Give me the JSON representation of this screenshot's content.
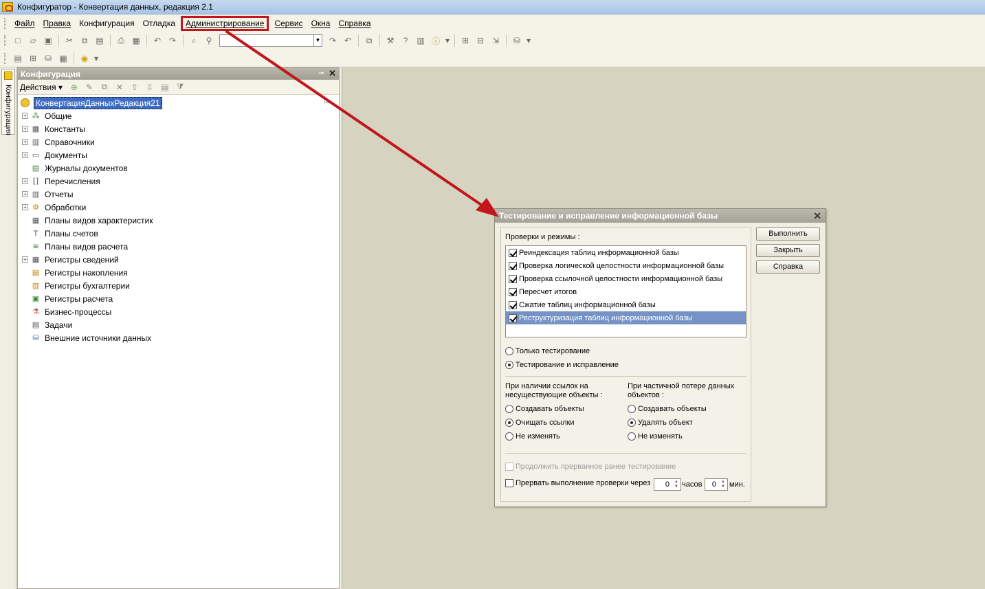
{
  "window": {
    "title": "Конфигуратор - Конвертация данных, редакция 2.1"
  },
  "menu": {
    "items": [
      "Файл",
      "Правка",
      "Конфигурация",
      "Отладка",
      "Администрирование",
      "Сервис",
      "Окна",
      "Справка"
    ]
  },
  "side_tab": {
    "label": "Конфигурация"
  },
  "config_panel": {
    "title": "Конфигурация",
    "actions_label": "Действия",
    "root": "КонвертацияДанныхРедакция21",
    "tree": [
      "Общие",
      "Константы",
      "Справочники",
      "Документы",
      "Журналы документов",
      "Перечисления",
      "Отчеты",
      "Обработки",
      "Планы видов характеристик",
      "Планы счетов",
      "Планы видов расчета",
      "Регистры сведений",
      "Регистры накопления",
      "Регистры бухгалтерии",
      "Регистры расчета",
      "Бизнес-процессы",
      "Задачи",
      "Внешние источники данных"
    ]
  },
  "dialog": {
    "title": "Тестирование и исправление информационной базы",
    "checks_label": "Проверки и режимы :",
    "checks": [
      "Реиндексация таблиц информационной базы",
      "Проверка логической целостности информационной базы",
      "Проверка ссылочной целостности информационной базы",
      "Пересчет итогов",
      "Сжатие таблиц информационной базы",
      "Реструктуризация таблиц информационной базы"
    ],
    "mode_test_only": "Только тестирование",
    "mode_test_fix": "Тестирование и исправление",
    "refs_label": "При наличии ссылок на несуществующие объекты :",
    "refs_options": [
      "Создавать объекты",
      "Очищать ссылки",
      "Не изменять"
    ],
    "loss_label": "При частичной потере данных объектов :",
    "loss_options": [
      "Создавать объекты",
      "Удалять объект",
      "Не изменять"
    ],
    "continue_label": "Продолжить прерванное ранее тестирование",
    "interrupt_label": "Прервать выполнение проверки через",
    "hours_value": "0",
    "hours_label": "часов",
    "minutes_value": "0",
    "minutes_label": "мин.",
    "buttons": {
      "run": "Выполнить",
      "close": "Закрыть",
      "help": "Справка"
    }
  },
  "colors": {
    "highlight_box": "#c0161c",
    "arrow": "#c0161c",
    "selection": "#3d6cc4"
  }
}
